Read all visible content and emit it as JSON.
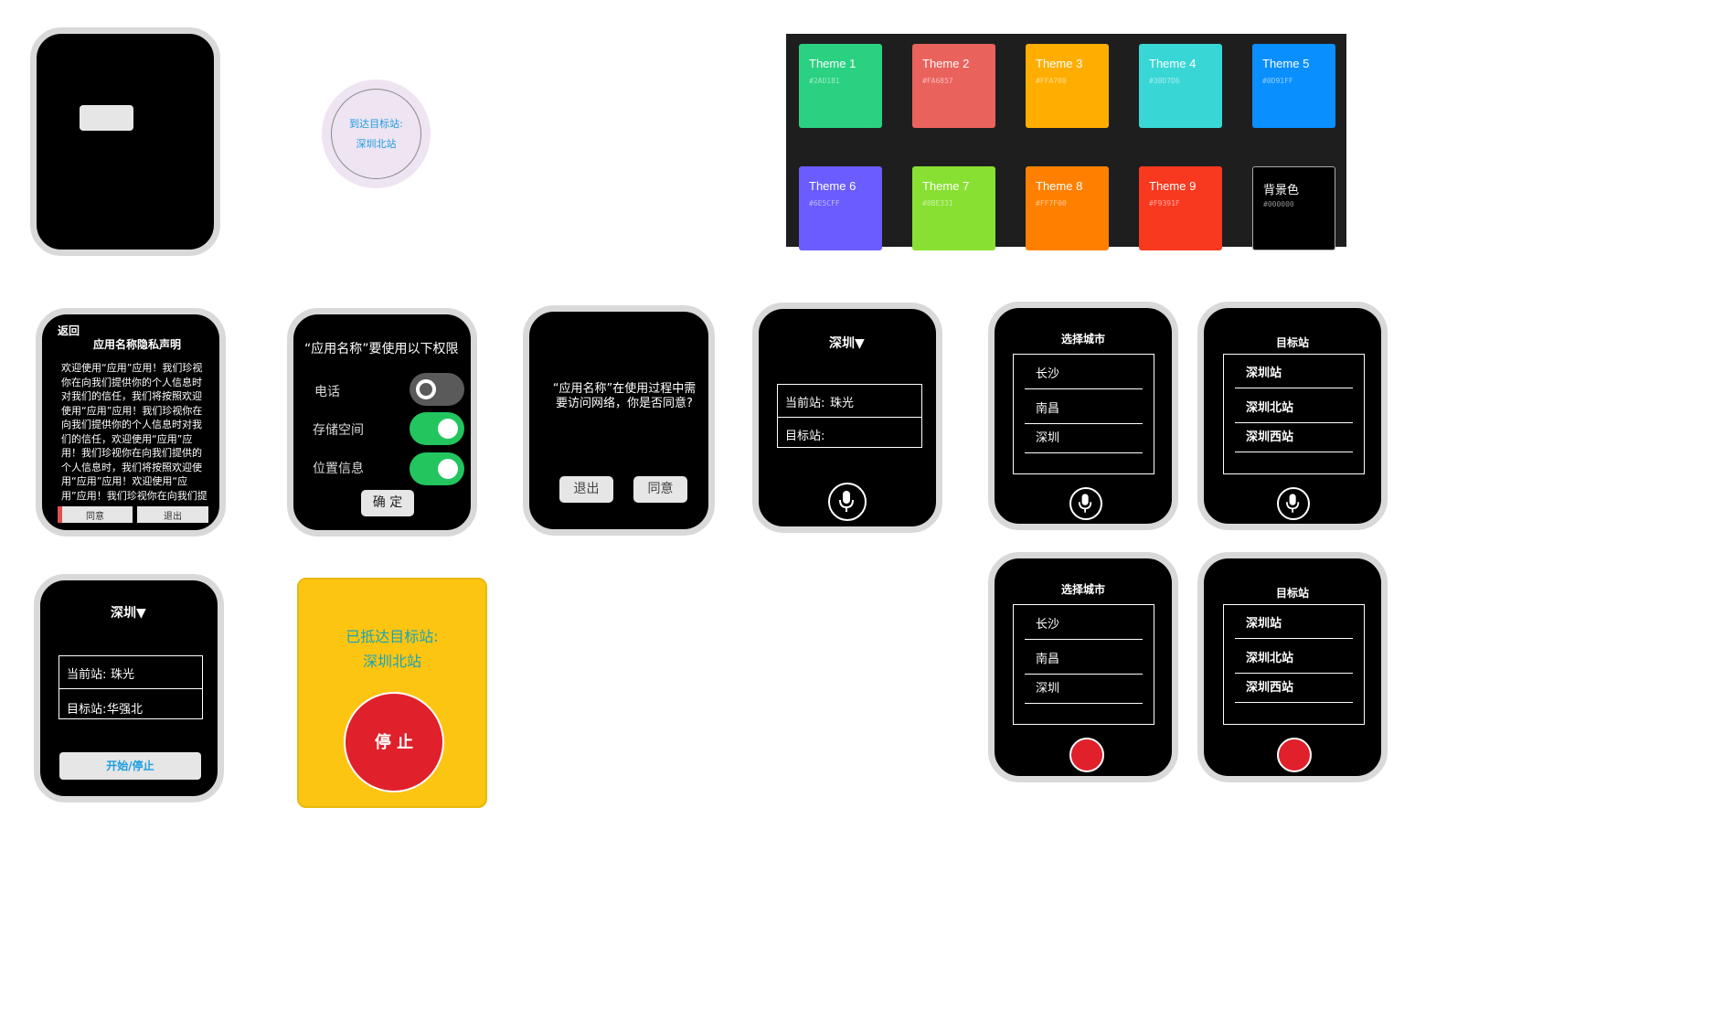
{
  "colors": {
    "watch_bezel": "#d9d9d9",
    "watch_face": "#000000",
    "accent_blue": "#1a9ee0",
    "toggle_on": "#22c55e",
    "stop_red": "#e0202a",
    "yellow_bg": "#fcc512"
  },
  "notification": {
    "line1": "到达目标站:",
    "line2": "深圳北站"
  },
  "themes": [
    {
      "name": "Theme 1",
      "hex": "#2AD181",
      "color": "#2ad181"
    },
    {
      "name": "Theme 2",
      "hex": "#FA6857",
      "color": "#ea625c"
    },
    {
      "name": "Theme 3",
      "hex": "#FFA700",
      "color": "#ffae00"
    },
    {
      "name": "Theme 4",
      "hex": "#38D7D6",
      "color": "#38d7d6"
    },
    {
      "name": "Theme 5",
      "hex": "#0D91FF",
      "color": "#0a8fff"
    },
    {
      "name": "Theme 6",
      "hex": "#6E5CFF",
      "color": "#6b5cff"
    },
    {
      "name": "Theme 7",
      "hex": "#8BE331",
      "color": "#88e032"
    },
    {
      "name": "Theme 8",
      "hex": "#FF7F00",
      "color": "#ff8000"
    },
    {
      "name": "Theme 9",
      "hex": "#F9391F",
      "color": "#f9391f"
    },
    {
      "name": "背景色",
      "hex": "#000000",
      "color": "#000000"
    }
  ],
  "privacy": {
    "back": "返回",
    "title": "应用名称隐私声明",
    "body": "欢迎使用“应用”应用！我们珍视你在向我们提供你的个人信息时对我们的信任，我们将按照欢迎使用“应用”应用！我们珍视你在向我们提供你的个人信息时对我们的信任，欢迎使用“应用”应用！我们珍视你在向我们提供的个人信息时，我们将按照欢迎使用“应用”应用！欢迎使用“应用”应用！我们珍视你在向我们提供你的个人信息时",
    "agree": "同意",
    "exit": "退出"
  },
  "permissions": {
    "title": "“应用名称”要使用以下权限",
    "items": [
      {
        "label": "电话",
        "on": false
      },
      {
        "label": "存储空间",
        "on": true
      },
      {
        "label": "位置信息",
        "on": true
      }
    ],
    "confirm": "确 定"
  },
  "network": {
    "message": "“应用名称”在使用过程中需要访问网络，你是否同意?",
    "exit": "退出",
    "agree": "同意"
  },
  "station_select": {
    "city": "深圳▼",
    "current_label": "当前站:",
    "current_value": "珠光",
    "target_label": "目标站:",
    "target_value": ""
  },
  "city_select": {
    "title": "选择城市",
    "items": [
      "长沙",
      "南昌",
      "深圳"
    ]
  },
  "target_station": {
    "title": "目标站",
    "items": [
      "深圳站",
      "深圳北站",
      "深圳西站"
    ]
  },
  "station_filled": {
    "city": "深圳▼",
    "current_label": "当前站:",
    "current_value": "珠光",
    "target_label": "目标站:",
    "target_value": "华强北",
    "button": "开始/停止"
  },
  "arrived": {
    "line1": "已抵达目标站:",
    "line2": "深圳北站",
    "stop": "停 止"
  }
}
